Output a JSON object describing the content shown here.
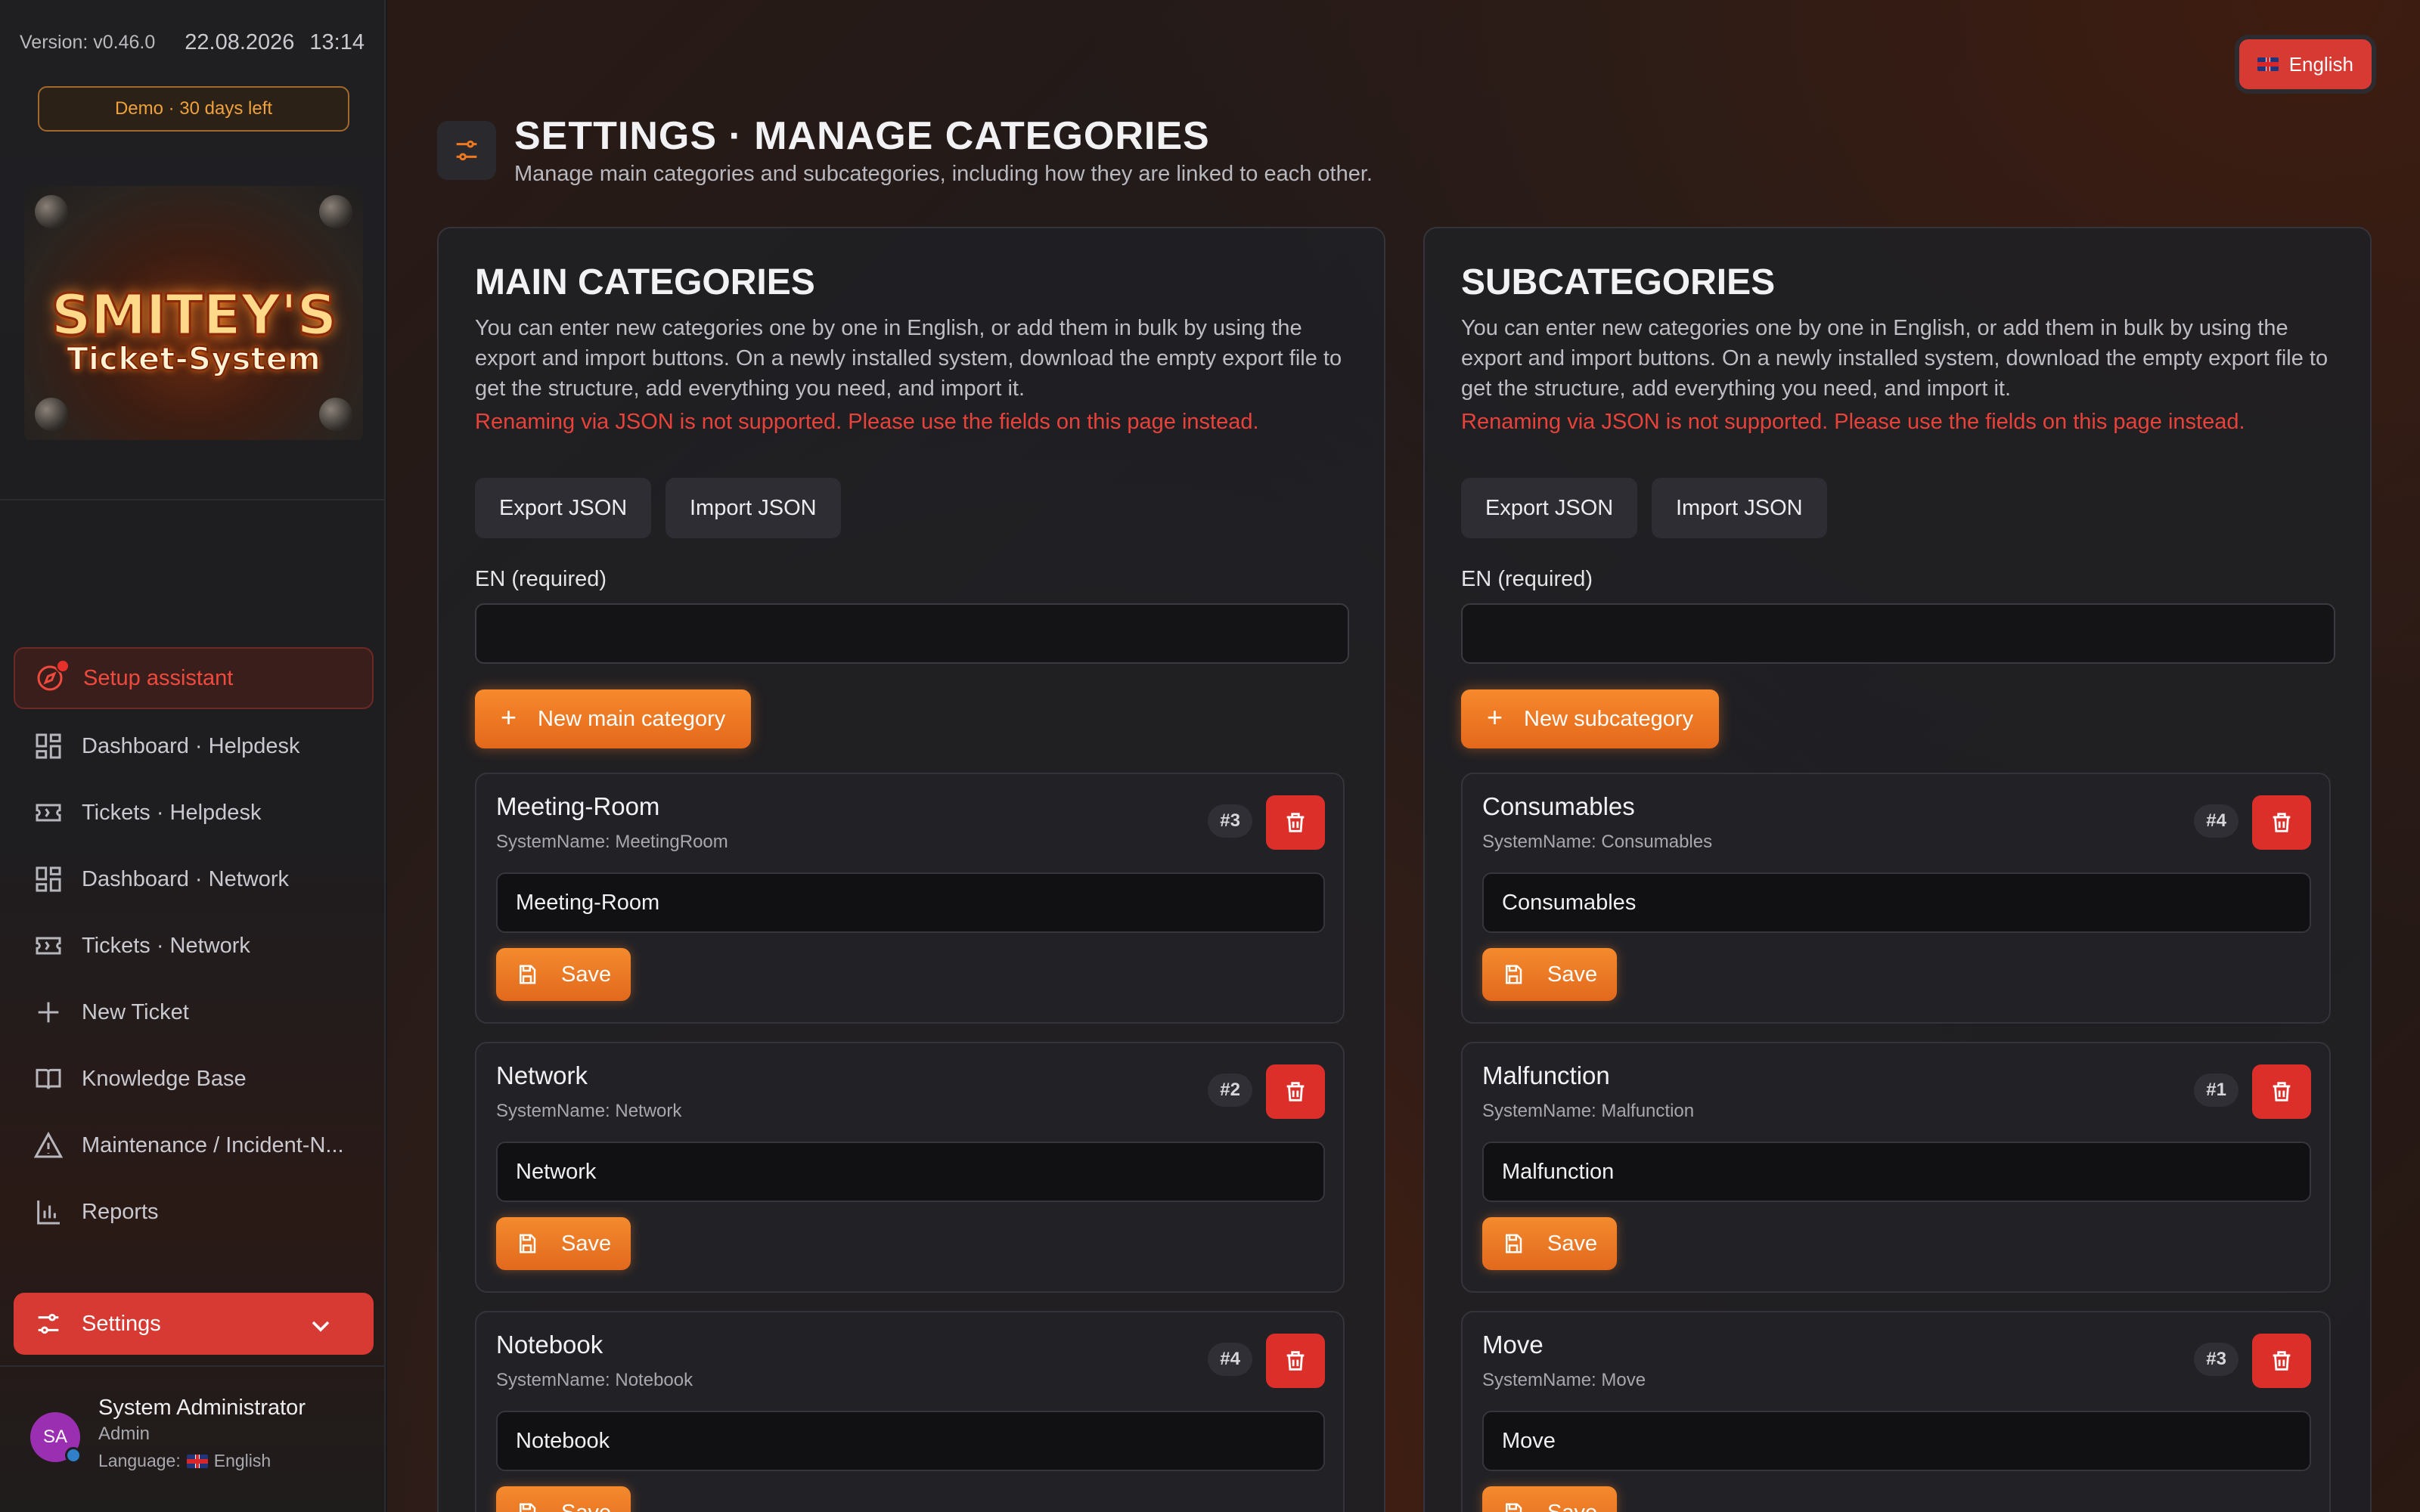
{
  "sidebar": {
    "version": "Version: v0.46.0",
    "date": "22.08.2026",
    "time": "13:14",
    "demo_badge": "Demo · 30 days left",
    "logo": {
      "line1": "SMITEY'S",
      "line2": "Ticket-System"
    },
    "nav": [
      {
        "label": "Setup assistant",
        "icon": "compass-icon"
      },
      {
        "label": "Dashboard · Helpdesk",
        "icon": "dashboard-icon"
      },
      {
        "label": "Tickets · Helpdesk",
        "icon": "ticket-icon"
      },
      {
        "label": "Dashboard · Network",
        "icon": "dashboard-icon"
      },
      {
        "label": "Tickets · Network",
        "icon": "ticket-icon"
      },
      {
        "label": "New Ticket",
        "icon": "plus-icon"
      },
      {
        "label": "Knowledge Base",
        "icon": "book-icon"
      },
      {
        "label": "Maintenance / Incident-N...",
        "icon": "warning-icon"
      },
      {
        "label": "Reports",
        "icon": "bar-chart-icon"
      },
      {
        "label": "Settings",
        "icon": "sliders-icon"
      }
    ],
    "user": {
      "initials": "SA",
      "name": "System Administrator",
      "role": "Admin",
      "language_label": "Language:",
      "language": "English"
    }
  },
  "header": {
    "language_button": "English",
    "title": "SETTINGS · MANAGE CATEGORIES",
    "subtitle": "Manage main categories and subcategories, including how they are linked to each other."
  },
  "main_categories": {
    "title": "MAIN CATEGORIES",
    "description": "You can enter new categories one by one in English, or add them in bulk by using the export and import buttons. On a newly installed system, download the empty export file to get the structure, add everything you need, and import it.",
    "warning": "Renaming via JSON is not supported. Please use the fields on this page instead.",
    "export_label": "Export JSON",
    "import_label": "Import JSON",
    "field_label": "EN (required)",
    "field_value": "",
    "new_button": "New main category",
    "items": [
      {
        "name": "Meeting-Room",
        "system_name": "SystemName: MeetingRoom",
        "id": "#3",
        "value": "Meeting-Room",
        "save": "Save"
      },
      {
        "name": "Network",
        "system_name": "SystemName: Network",
        "id": "#2",
        "value": "Network",
        "save": "Save"
      },
      {
        "name": "Notebook",
        "system_name": "SystemName: Notebook",
        "id": "#4",
        "value": "Notebook",
        "save": "Save"
      }
    ]
  },
  "subcategories": {
    "title": "SUBCATEGORIES",
    "description": "You can enter new categories one by one in English, or add them in bulk by using the export and import buttons. On a newly installed system, download the empty export file to get the structure, add everything you need, and import it.",
    "warning": "Renaming via JSON is not supported. Please use the fields on this page instead.",
    "export_label": "Export JSON",
    "import_label": "Import JSON",
    "field_label": "EN (required)",
    "field_value": "",
    "new_button": "New subcategory",
    "items": [
      {
        "name": "Consumables",
        "system_name": "SystemName: Consumables",
        "id": "#4",
        "value": "Consumables",
        "save": "Save"
      },
      {
        "name": "Malfunction",
        "system_name": "SystemName: Malfunction",
        "id": "#1",
        "value": "Malfunction",
        "save": "Save"
      },
      {
        "name": "Move",
        "system_name": "SystemName: Move",
        "id": "#3",
        "value": "Move",
        "save": "Save"
      }
    ]
  },
  "colors": {
    "accent_red": "#d63a33",
    "accent_orange": "#f0781f",
    "warning_text": "#e8423a",
    "demo_badge": "#f0a13c"
  }
}
